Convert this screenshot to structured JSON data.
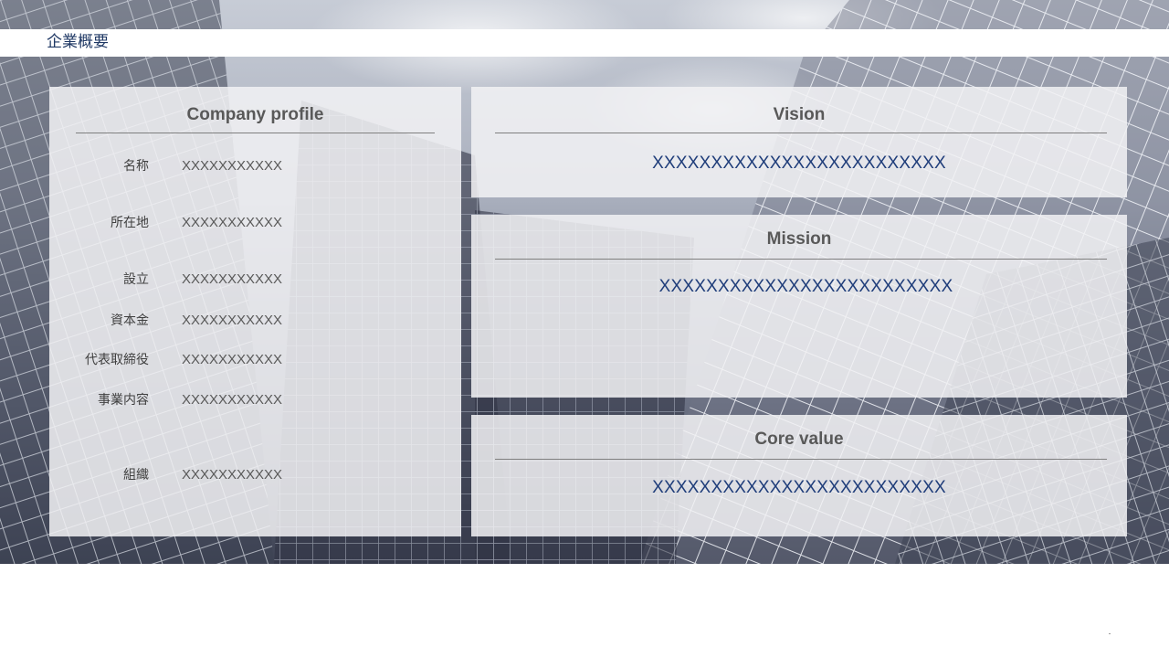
{
  "header": {
    "title": "企業概要"
  },
  "profile": {
    "heading": "Company profile",
    "rows": [
      {
        "label": "名称",
        "value": "XXXXXXXXXXX"
      },
      {
        "label": "所在地",
        "value": "XXXXXXXXXXX"
      },
      {
        "label": "設立",
        "value": "XXXXXXXXXXX"
      },
      {
        "label": "資本金",
        "value": "XXXXXXXXXXX"
      },
      {
        "label": "代表取締役",
        "value": "XXXXXXXXXXX"
      },
      {
        "label": "事業内容",
        "value": "XXXXXXXXXXX"
      },
      {
        "label": "組織",
        "value": "XXXXXXXXXXX"
      }
    ]
  },
  "vision": {
    "heading": "Vision",
    "text": "XXXXXXXXXXXXXXXXXXXXXXXXX"
  },
  "mission": {
    "heading": "Mission",
    "text": "XXXXXXXXXXXXXXXXXXXXXXXXX"
  },
  "core_value": {
    "heading": "Core value",
    "text": "XXXXXXXXXXXXXXXXXXXXXXXXX"
  },
  "colors": {
    "title": "#1f3864",
    "heading": "#595959",
    "accent_text": "#1f3d7a",
    "card": "#f2f2f4"
  }
}
